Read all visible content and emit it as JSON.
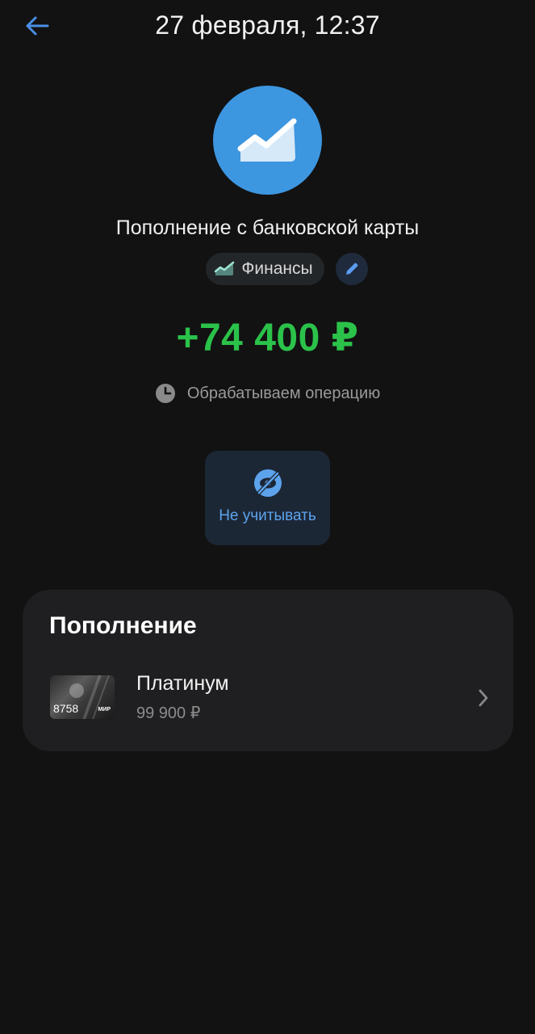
{
  "header": {
    "title": "27 февраля, 12:37",
    "back_icon": "arrow-left-icon"
  },
  "operation": {
    "category_icon": "finance-chart-icon",
    "title": "Пополнение с банковской карты",
    "category_chip": {
      "label": "Финансы",
      "icon": "finance-chart-icon"
    },
    "edit_icon": "pencil-icon",
    "amount": "+74 400 ₽",
    "status": {
      "icon": "clock-icon",
      "text": "Обрабатываем операцию"
    }
  },
  "actions": [
    {
      "label": "Не учитывать",
      "icon": "eye-off-icon"
    }
  ],
  "destination": {
    "title": "Пополнение",
    "account": {
      "name": "Платинум",
      "balance": "99 900 ₽",
      "card_last_digits": "8758",
      "card_brand": "МИР",
      "chevron_icon": "chevron-right-icon"
    }
  },
  "colors": {
    "background": "#121212",
    "accent_blue": "#3d96e0",
    "amount_green": "#2bc24a",
    "action_tile_bg": "#1c2736",
    "action_text": "#5da3ec",
    "card_block_bg": "#1f1f21"
  }
}
